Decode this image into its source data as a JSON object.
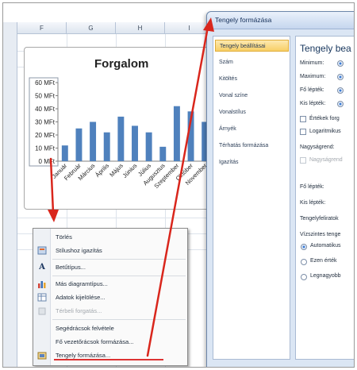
{
  "sheet": {
    "columns": [
      "F",
      "G",
      "H",
      "I"
    ]
  },
  "chart_data": {
    "type": "bar",
    "title": "Forgalom",
    "xlabel": "",
    "ylabel": "",
    "categories": [
      "Január",
      "Február",
      "Március",
      "Április",
      "Május",
      "Június",
      "Július",
      "Augusztus",
      "Szeptember",
      "Október",
      "November"
    ],
    "values": [
      12,
      25,
      30,
      22,
      34,
      27,
      22,
      11,
      42,
      38,
      30
    ],
    "ylim": [
      0,
      60
    ],
    "y_ticks": [
      "0 MFt",
      "10 MFt",
      "20 MFt",
      "30 MFt",
      "40 MFt",
      "50 MFt",
      "60 MFt"
    ],
    "bar_color": "#4f81bd",
    "grid": false,
    "legend": "none"
  },
  "context_menu": {
    "items": [
      {
        "label": "Törlés",
        "icon": "none",
        "enabled": true
      },
      {
        "label": "Stílushoz igazítás",
        "icon": "style-icon",
        "enabled": true
      },
      {
        "label": "Betűtípus...",
        "icon": "font-icon",
        "enabled": true
      },
      {
        "label": "Más diagramtípus...",
        "icon": "chart-type-icon",
        "enabled": true
      },
      {
        "label": "Adatok kijelölése...",
        "icon": "select-data-icon",
        "enabled": true
      },
      {
        "label": "Térbeli forgatás...",
        "icon": "3d-rotation-icon",
        "enabled": false
      },
      {
        "label": "Segédrácsok felvétele",
        "icon": "none",
        "enabled": true
      },
      {
        "label": "Fő vezetőrácsok formázása...",
        "icon": "none",
        "enabled": true
      },
      {
        "label": "Tengely formázása...",
        "icon": "format-axis-icon",
        "enabled": true
      }
    ]
  },
  "dialog": {
    "title": "Tengely formázása",
    "nav": [
      "Tengely beállításai",
      "Szám",
      "Kitöltés",
      "Vonal színe",
      "Vonalstílus",
      "Árnyék",
      "Térhatás formázása",
      "Igazítás"
    ],
    "selected_nav": 0,
    "panel": {
      "heading": "Tengely bea",
      "minimum": "Minimum:",
      "maximum": "Maximum:",
      "major_unit": "Fő lépték:",
      "minor_unit": "Kis lépték:",
      "values_reverse": "Értékek forg",
      "log_scale": "Logaritmikus",
      "display_units": "Nagyságrend:",
      "display_units_label": "Nagyságrend",
      "major_tick": "Fő lépték:",
      "minor_tick": "Kis lépték:",
      "tick_labels": "Tengelyfeliratok",
      "crosses_heading": "Vízszintes tenge",
      "crosses_auto": "Automatikus",
      "crosses_value": "Ezen érték",
      "crosses_max": "Legnagyobb"
    }
  },
  "colors": {
    "annotation_arrow": "#d9261c"
  }
}
